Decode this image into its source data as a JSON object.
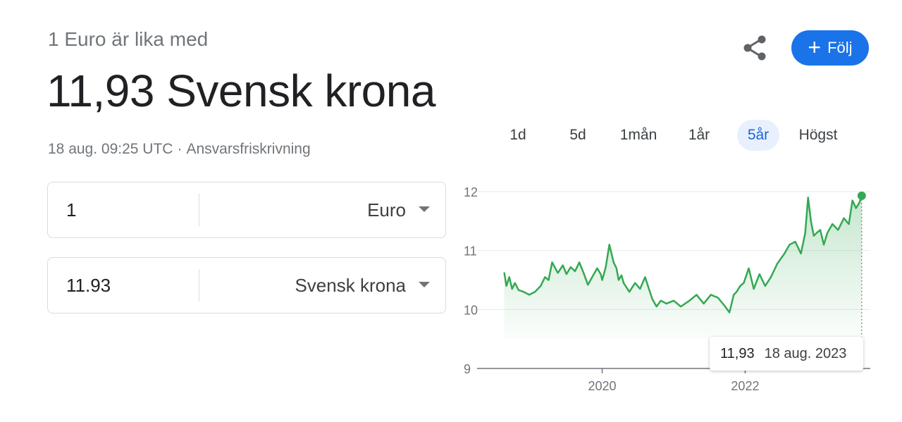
{
  "header": {
    "subtitle": "1 Euro är lika med",
    "value_text": "11,93 Svensk krona",
    "timestamp": "18 aug. 09:25 UTC",
    "separator": "·",
    "disclaimer": "Ansvarsfriskrivning"
  },
  "actions": {
    "share_icon": "share-icon",
    "follow_label": "Följ",
    "follow_icon": "+",
    "accent_color": "#1a73e8"
  },
  "tabs": [
    {
      "label": "1d",
      "active": false
    },
    {
      "label": "5d",
      "active": false
    },
    {
      "label": "1mån",
      "active": false
    },
    {
      "label": "1år",
      "active": false
    },
    {
      "label": "5år",
      "active": true
    },
    {
      "label": "Högst",
      "active": false
    }
  ],
  "converter": {
    "from": {
      "value": "1",
      "currency": "Euro"
    },
    "to": {
      "value": "11.93",
      "currency": "Svensk krona"
    }
  },
  "tooltip": {
    "value": "11,93",
    "date": "18 aug. 2023"
  },
  "chart_data": {
    "type": "area",
    "y_ticks": [
      "12",
      "11",
      "10",
      "9"
    ],
    "ylim": [
      9,
      12
    ],
    "x_ticks": [
      {
        "label": "2020",
        "x": 2020.0
      },
      {
        "label": "2022",
        "x": 2022.0
      }
    ],
    "xlim": [
      2018.25,
      2023.75
    ],
    "line_color": "#34a853",
    "grid": true,
    "series": [
      {
        "x": [
          2018.63,
          2018.66,
          2018.7,
          2018.74,
          2018.78,
          2018.83,
          2018.9,
          2018.98,
          2019.06,
          2019.14,
          2019.2,
          2019.25,
          2019.3,
          2019.38,
          2019.45,
          2019.5,
          2019.56,
          2019.62,
          2019.68,
          2019.74,
          2019.8,
          2019.86,
          2019.93,
          2019.98,
          2020.0,
          2020.05,
          2020.1,
          2020.16,
          2020.2,
          2020.23,
          2020.27,
          2020.3,
          2020.38,
          2020.46,
          2020.53,
          2020.6,
          2020.7,
          2020.76,
          2020.82,
          2020.9,
          2021.0,
          2021.1,
          2021.22,
          2021.32,
          2021.42,
          2021.52,
          2021.62,
          2021.72,
          2021.78,
          2021.84,
          2021.88,
          2021.93,
          2021.98,
          2022.05,
          2022.12,
          2022.2,
          2022.28,
          2022.36,
          2022.45,
          2022.55,
          2022.62,
          2022.7,
          2022.78,
          2022.84,
          2022.88,
          2022.92,
          2022.96,
          2023.0,
          2023.05,
          2023.1,
          2023.15,
          2023.22,
          2023.3,
          2023.38,
          2023.45,
          2023.5,
          2023.55,
          2023.6,
          2023.63
        ],
        "y": [
          10.63,
          10.4,
          10.55,
          10.35,
          10.45,
          10.33,
          10.3,
          10.25,
          10.3,
          10.4,
          10.55,
          10.5,
          10.8,
          10.62,
          10.75,
          10.6,
          10.72,
          10.65,
          10.8,
          10.62,
          10.42,
          10.55,
          10.7,
          10.6,
          10.5,
          10.72,
          11.1,
          10.8,
          10.7,
          10.5,
          10.58,
          10.45,
          10.3,
          10.45,
          10.35,
          10.55,
          10.18,
          10.05,
          10.15,
          10.1,
          10.15,
          10.05,
          10.15,
          10.25,
          10.1,
          10.25,
          10.2,
          10.05,
          9.95,
          10.25,
          10.3,
          10.4,
          10.45,
          10.7,
          10.35,
          10.6,
          10.4,
          10.55,
          10.78,
          10.95,
          11.1,
          11.15,
          10.95,
          11.3,
          11.9,
          11.5,
          11.25,
          11.3,
          11.35,
          11.1,
          11.3,
          11.45,
          11.35,
          11.55,
          11.45,
          11.85,
          11.72,
          11.82,
          11.93
        ]
      }
    ]
  }
}
